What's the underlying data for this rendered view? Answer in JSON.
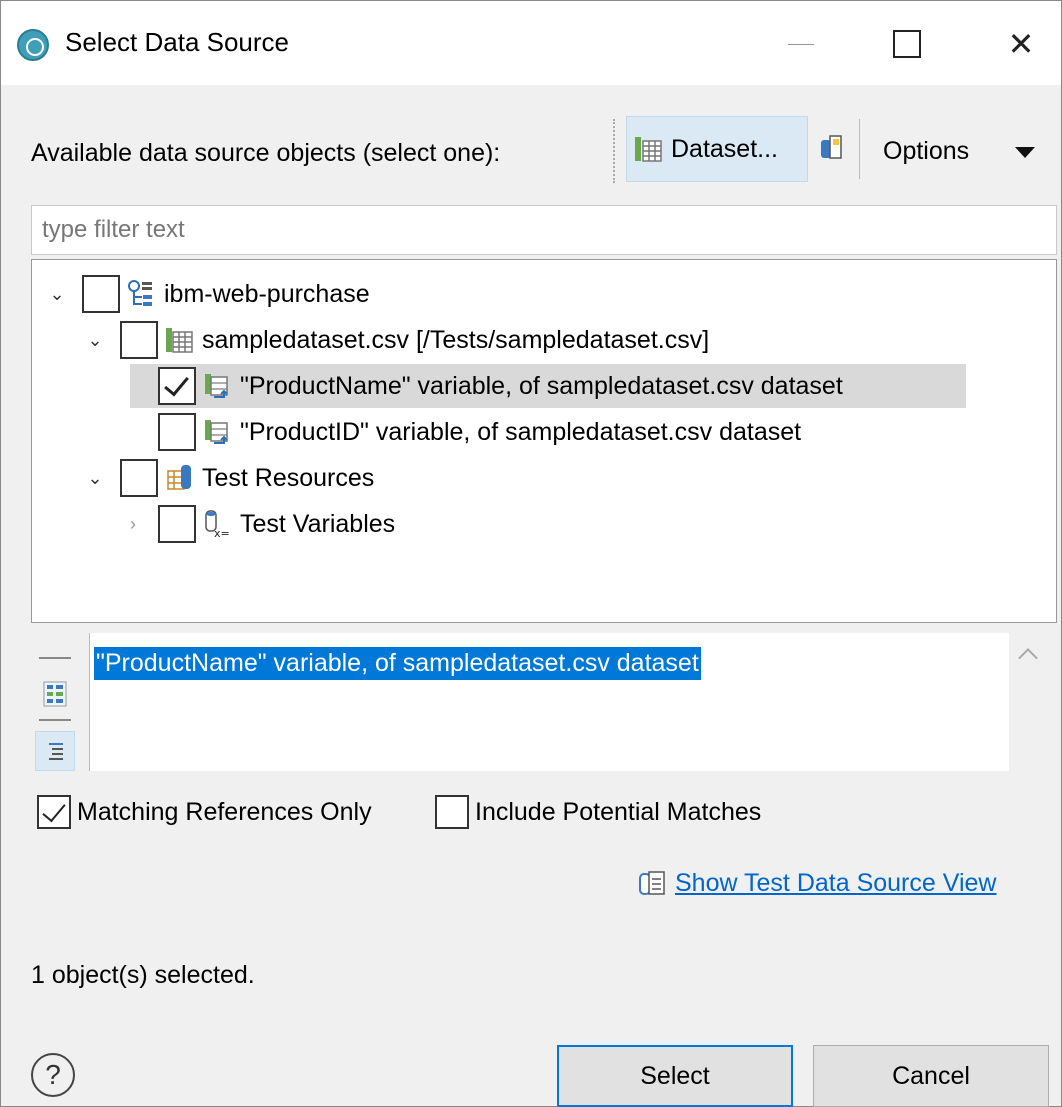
{
  "window": {
    "title": "Select Data Source"
  },
  "toolbar": {
    "label": "Available data source objects (select one):",
    "dataset_button": "Dataset...",
    "options_label": "Options"
  },
  "filter": {
    "placeholder": "type filter text",
    "value": ""
  },
  "tree": {
    "items": [
      {
        "label": "ibm-web-purchase",
        "icon": "test-suite-icon",
        "expanded": true,
        "checked": false
      },
      {
        "label": "sampledataset.csv [/Tests/sampledataset.csv]",
        "icon": "dataset-icon",
        "expanded": true,
        "checked": false
      },
      {
        "label": "\"ProductName\" variable, of sampledataset.csv dataset",
        "icon": "dataset-variable-icon",
        "checked": true,
        "selected": true
      },
      {
        "label": "\"ProductID\" variable, of sampledataset.csv dataset",
        "icon": "dataset-variable-icon",
        "checked": false
      },
      {
        "label": "Test Resources",
        "icon": "test-resources-icon",
        "expanded": true,
        "checked": false
      },
      {
        "label": "Test Variables",
        "icon": "test-variables-icon",
        "expanded": false,
        "checked": false
      }
    ]
  },
  "preview": {
    "text": "\"ProductName\" variable, of sampledataset.csv dataset"
  },
  "options": {
    "matching_only": {
      "label": "Matching References Only",
      "checked": true
    },
    "potential": {
      "label": "Include Potential Matches",
      "checked": false
    }
  },
  "link": {
    "label": "Show Test Data Source View"
  },
  "status": "1 object(s) selected.",
  "buttons": {
    "select": "Select",
    "cancel": "Cancel"
  },
  "colors": {
    "selection": "#0078d7",
    "link": "#0066cc",
    "row_selected": "#d9d9d9"
  }
}
